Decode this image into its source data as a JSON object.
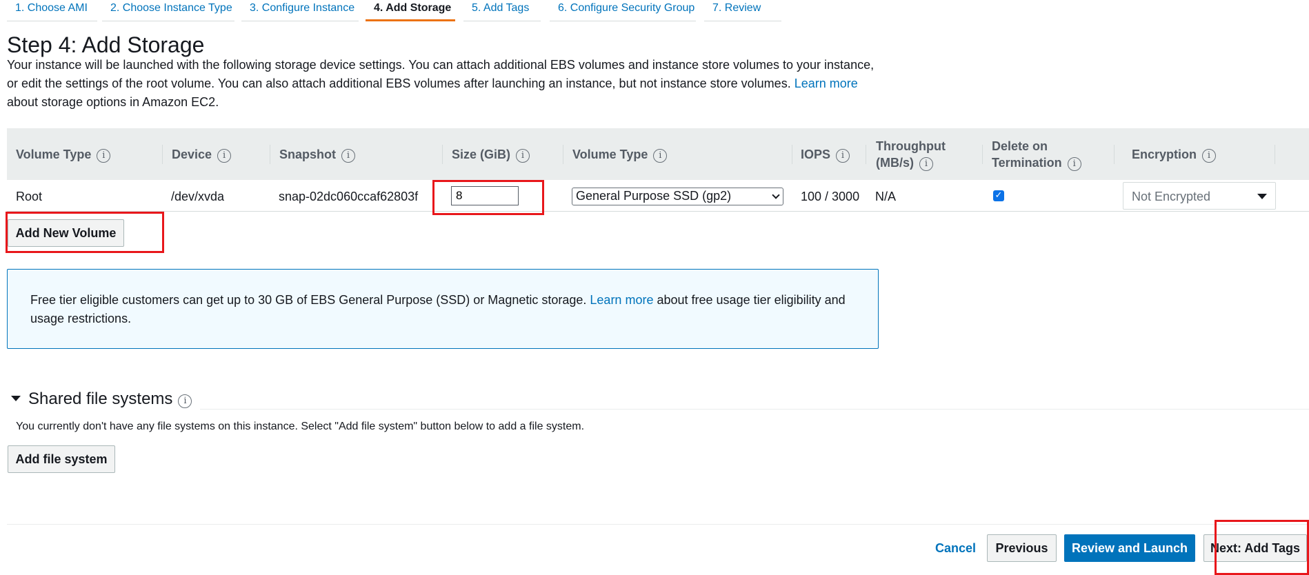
{
  "wizard_tabs": [
    {
      "label": "1. Choose AMI"
    },
    {
      "label": "2. Choose Instance Type"
    },
    {
      "label": "3. Configure Instance"
    },
    {
      "label": "4. Add Storage"
    },
    {
      "label": "5. Add Tags"
    },
    {
      "label": "6. Configure Security Group"
    },
    {
      "label": "7. Review"
    }
  ],
  "active_tab": "4. Add Storage",
  "page": {
    "title": "Step 4: Add Storage",
    "intro_before_link": "Your instance will be launched with the following storage device settings. You can attach additional EBS volumes and instance store volumes to your instance, or edit the settings of the root volume. You can also attach additional EBS volumes after launching an instance, but not instance store volumes.",
    "intro_link": "Learn more",
    "intro_after_link": "about storage options in Amazon EC2."
  },
  "table": {
    "headers": {
      "volume_type": "Volume Type",
      "device": "Device",
      "snapshot": "Snapshot",
      "size": "Size (GiB)",
      "volume_type2": "Volume Type",
      "iops": "IOPS",
      "throughput_line1": "Throughput",
      "throughput_line2": "(MB/s)",
      "delete_line1": "Delete on",
      "delete_line2": "Termination",
      "encryption": "Encryption"
    },
    "row": {
      "volume_type": "Root",
      "device": "/dev/xvda",
      "snapshot": "snap-02dc060ccaf62803f",
      "size": "8",
      "ebs_type": "General Purpose SSD (gp2)",
      "iops": "100 / 3000",
      "throughput": "N/A",
      "delete_on_termination": true,
      "encryption": "Not Encrypted"
    }
  },
  "buttons": {
    "add_new_volume": "Add New Volume",
    "add_file_system": "Add file system",
    "cancel": "Cancel",
    "previous": "Previous",
    "review_and_launch": "Review and Launch",
    "next": "Next: Add Tags"
  },
  "alert": {
    "text_before_link": "Free tier eligible customers can get up to 30 GB of EBS General Purpose (SSD) or Magnetic storage.",
    "link": "Learn more",
    "text_after_link": "about free usage tier eligibility and usage restrictions."
  },
  "shared_fs": {
    "title": "Shared file systems",
    "empty_text": "You currently don't have any file systems on this instance. Select \"Add file system\" button below to add a file system."
  },
  "colors": {
    "link": "#0073bb",
    "primary_button": "#0073bb",
    "active_tab_underline": "#ec7211",
    "highlight_box": "#e8171b",
    "alert_background": "#f1faff"
  }
}
